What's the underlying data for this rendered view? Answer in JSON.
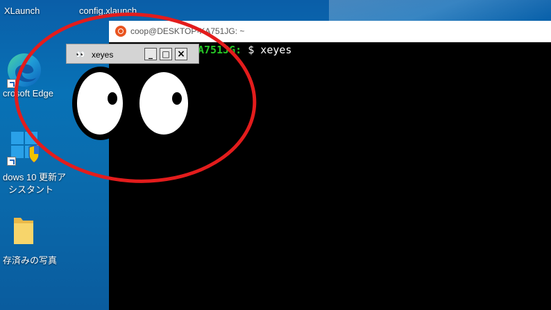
{
  "desktop": {
    "top_labels": [
      "XLaunch",
      "config.xlaunch"
    ],
    "icons": [
      {
        "icon": "edge-icon",
        "label": "crosoft Edge"
      },
      {
        "icon": "windows-update-assistant-icon",
        "label_line1": "dows 10 更新ア",
        "label_line2": "シスタント"
      },
      {
        "icon": "folder-icon",
        "label": "存済みの写真"
      }
    ]
  },
  "terminal": {
    "title": "coop@DESKTOP-KA751JG: ~",
    "prompt_host": "A751JG:",
    "prompt_tail": " $ xeyes"
  },
  "xeyes": {
    "title": "xeyes",
    "minimize_glyph": "_",
    "maximize_glyph": "□",
    "close_glyph": "×"
  },
  "colors": {
    "annotation": "#e31c1c",
    "prompt_green": "#26c726",
    "ubuntu_orange": "#e95420"
  }
}
